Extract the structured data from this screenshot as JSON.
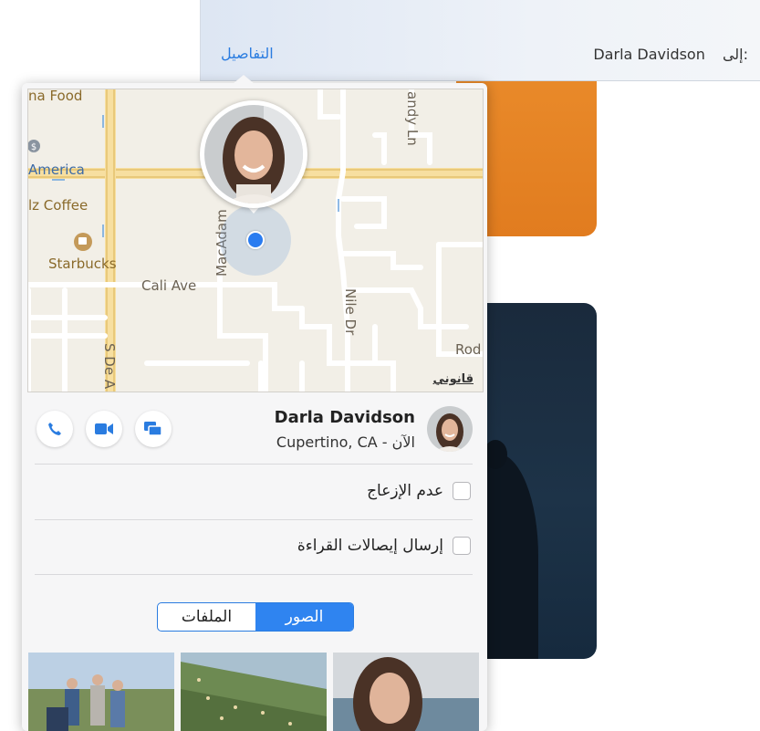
{
  "header": {
    "details_label": "التفاصيل",
    "to_label": "إلى:",
    "recipient": "Darla Davidson"
  },
  "map": {
    "labels": {
      "food": "na Food",
      "america": "America",
      "coffee": "lz Coffee",
      "starbucks": "Starbucks",
      "cali_ave": "Cali Ave",
      "macadam": "MacAdam",
      "andy_ln": "andy Ln",
      "nile_dr": "Nile Dr",
      "rod": "Rod",
      "s_de_a": "S De A"
    },
    "legal": "قانوني",
    "accent_color": "#2a7cf0"
  },
  "contact": {
    "name": "Darla Davidson",
    "location": "Cupertino, CA - الآن",
    "actions": [
      "message-icon",
      "video-icon",
      "phone-icon"
    ]
  },
  "options": {
    "do_not_disturb": "عدم الإزعاج",
    "read_receipts": "إرسال إيصالات القراءة"
  },
  "tabs": {
    "photos": "الصور",
    "files": "الملفات",
    "selected": "الصور"
  },
  "colors": {
    "accent": "#2f84f0",
    "link": "#2a7ce0"
  }
}
